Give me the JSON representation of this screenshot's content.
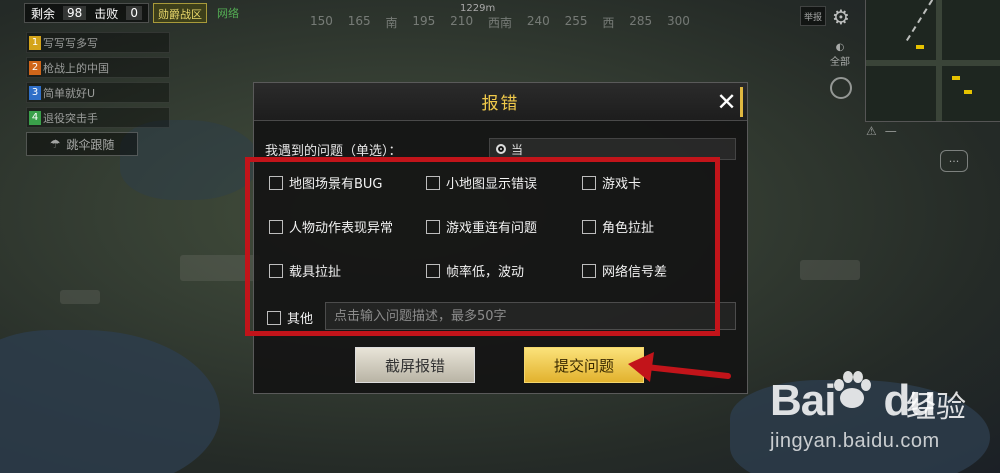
{
  "hud": {
    "remaining_label": "剩余",
    "remaining_value": "98",
    "kills_label": "击败",
    "kills_value": "0",
    "match_tag": "勋爵战区",
    "network": "网络",
    "compass_distance": "1229m",
    "compass_ticks": [
      "150",
      "165",
      "南",
      "195",
      "210",
      "西南",
      "240",
      "255",
      "西",
      "285",
      "300"
    ],
    "report_label": "举报",
    "all_label": "全部",
    "follow_label": "跳伞跟随",
    "map_icons": [
      "⚠",
      "—"
    ]
  },
  "team": [
    {
      "num": "1",
      "name": "写写写多写",
      "color": "#d4a41a"
    },
    {
      "num": "2",
      "name": "枪战上的中国",
      "color": "#d0661a"
    },
    {
      "num": "3",
      "name": "简单就好U",
      "color": "#2f6fc8"
    },
    {
      "num": "4",
      "name": "退役突击手",
      "color": "#3aa04a"
    }
  ],
  "dialog": {
    "title": "报错",
    "close_label": "✕",
    "prompt": "我遇到的问题（单选）：",
    "radio_text": "当",
    "options": [
      "地图场景有BUG",
      "小地图显示错误",
      "游戏卡",
      "人物动作表现异常",
      "游戏重连有问题",
      "角色拉扯",
      "载具拉扯",
      "帧率低，波动",
      "网络信号差"
    ],
    "other_label": "其他",
    "other_placeholder": "点击输入问题描述，最多50字",
    "screenshot_button": "截屏报错",
    "submit_button": "提交问题"
  },
  "watermark": {
    "brand_left": "Bai",
    "brand_right": "du",
    "brand_cn": "经验",
    "url": "jingyan.baidu.com"
  },
  "colors": {
    "highlight_frame": "#c2141a",
    "title_gold": "#f0c94a",
    "submit_gold": "#e2b22e"
  }
}
